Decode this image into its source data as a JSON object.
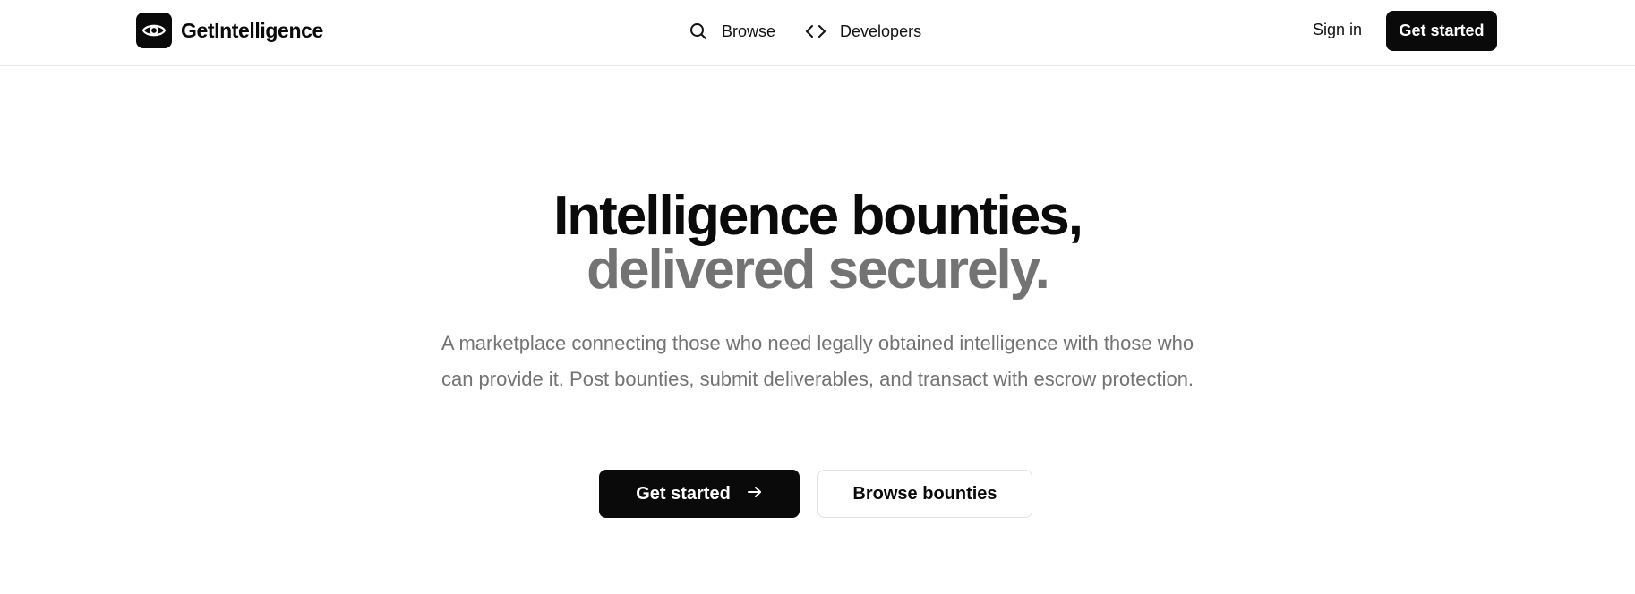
{
  "brand": {
    "name": "GetIntelligence",
    "logo_icon": "eye-icon"
  },
  "nav": {
    "items": [
      {
        "label": "Browse",
        "icon": "search-icon"
      },
      {
        "label": "Developers",
        "icon": "code-icon"
      }
    ],
    "sign_in": "Sign in",
    "get_started": "Get started"
  },
  "hero": {
    "title_line1": "Intelligence bounties,",
    "title_line2": "delivered securely.",
    "subtitle": "A marketplace connecting those who need legally obtained intelligence with those who can provide it. Post bounties, submit deliverables, and transact with escrow protection.",
    "primary_cta": "Get started",
    "primary_cta_icon": "arrow-right-icon",
    "secondary_cta": "Browse bounties"
  },
  "colors": {
    "primary": "#0a0a0a",
    "muted_text": "#737373",
    "border": "#e7e7e7"
  }
}
